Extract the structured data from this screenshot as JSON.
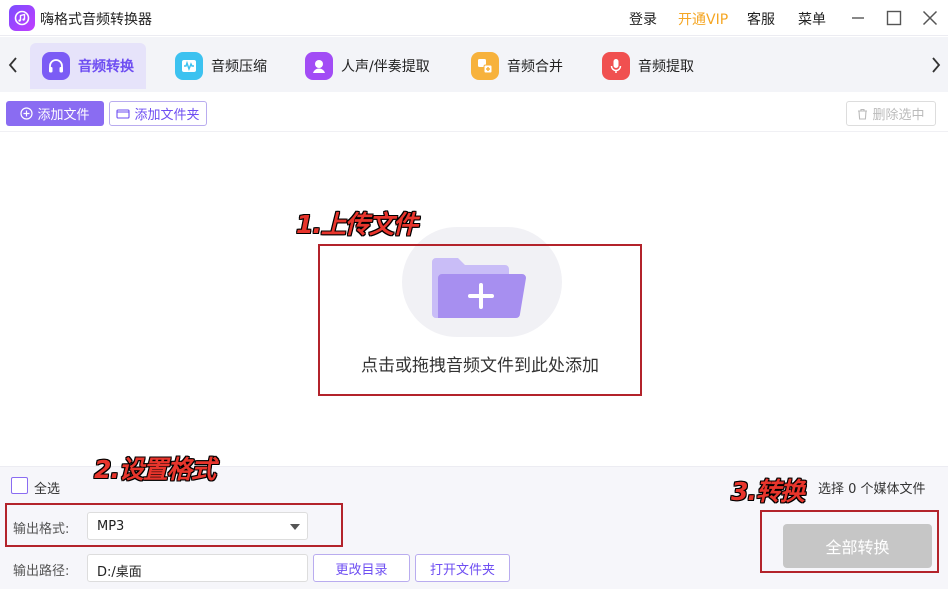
{
  "app": {
    "title": "嗨格式音频转换器"
  },
  "titlebar": {
    "login": "登录",
    "vip": "开通VIP",
    "service": "客服",
    "menu": "菜单"
  },
  "tabs": [
    {
      "label": "音频转换",
      "icon": "headphones-icon",
      "color": "#7b5cf5",
      "active": true
    },
    {
      "label": "音频压缩",
      "icon": "waveform-icon",
      "color": "#3cc2f0",
      "active": false
    },
    {
      "label": "人声/伴奏提取",
      "icon": "voice-icon",
      "color": "#a24cf5",
      "active": false
    },
    {
      "label": "音频合并",
      "icon": "merge-icon",
      "color": "#f7b23c",
      "active": false
    },
    {
      "label": "音频提取",
      "icon": "microphone-icon",
      "color": "#f05050",
      "active": false
    }
  ],
  "toolbar": {
    "add_file": "添加文件",
    "add_folder": "添加文件夹",
    "delete_selected": "删除选中"
  },
  "drop": {
    "text": "点击或拖拽音频文件到此处添加"
  },
  "annotations": {
    "step1": "1.上传文件",
    "step2": "2.设置格式",
    "step3": "3.转换"
  },
  "selection": {
    "select_all": "全选",
    "count_text": "选择 0 个媒体文件"
  },
  "output": {
    "format_label": "输出格式:",
    "format_value": "MP3",
    "path_label": "输出路径:",
    "path_value": "D:/桌面",
    "change_dir": "更改目录",
    "open_folder": "打开文件夹"
  },
  "convert_all": "全部转换",
  "colors": {
    "accent": "#6e4ef2",
    "annotation": "#b3232b",
    "annotation_text": "#e8352c"
  }
}
